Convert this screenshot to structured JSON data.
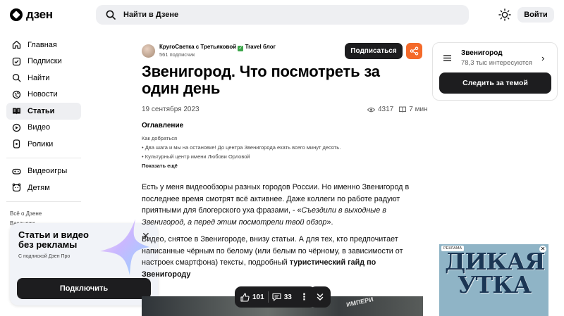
{
  "header": {
    "logo_text": "дзен",
    "search_placeholder": "Найти в Дзене",
    "login_label": "Войти"
  },
  "sidebar": {
    "items": [
      {
        "label": "Главная",
        "icon": "home-icon"
      },
      {
        "label": "Подписки",
        "icon": "subscriptions-icon"
      },
      {
        "label": "Найти",
        "icon": "search-icon"
      },
      {
        "label": "Новости",
        "icon": "globe-icon"
      },
      {
        "label": "Статьи",
        "icon": "articles-icon"
      },
      {
        "label": "Видео",
        "icon": "video-icon"
      },
      {
        "label": "Ролики",
        "icon": "shorts-icon"
      }
    ],
    "extra": [
      {
        "label": "Видеоигры",
        "icon": "gamepad-icon"
      },
      {
        "label": "Детям",
        "icon": "kids-icon"
      }
    ],
    "footer_links": [
      "Всё о Дзене",
      "Вакансии"
    ]
  },
  "promo": {
    "title": "Статьи и видео без рекламы",
    "subtitle": "С подпиской Дзен Про",
    "button": "Подключить"
  },
  "article": {
    "author_name": "КругоСветка с Третьяковой",
    "author_suffix": "Travel блог",
    "subscribers": "561 подписчик",
    "subscribe_label": "Подписаться",
    "title": "Звенигород. Что посмотреть за один день",
    "date": "19 сентября 2023",
    "views": "4317",
    "read_time": "7 мин",
    "toc_heading": "Оглавление",
    "toc": [
      "Как добраться",
      "• Два шага и мы на остановке! До центра Звенигорода ехать всего минут десять.",
      "• Культурный центр имени Любови Орловой"
    ],
    "toc_more": "Показать ещё",
    "p1_text": "Есть у меня видеообзоры разных городов России. Но именно Звенигород в последнее время смотрят всё активнее. Даже коллеги по работе радуют приятными для блогерского уха фразами, - «",
    "p1_italic": "Съездили в выходные в Звенигород, а перед этим посмотрели твой обзор",
    "p1_end": "».",
    "p2_text": "Видео, снятое в Звенигороде, внизу статьи. А для тех, кто предпочитает написанные чёрным по белому (или белым по чёрному, в зависимости от настроек смартфона) тексты, подробный ",
    "p2_bold": "туристический гайд по Звенигороду",
    "photo_text": "ИМПЕРИ"
  },
  "action_bar": {
    "likes": "101",
    "comments": "33"
  },
  "topic_widget": {
    "title": "Звенигород",
    "subtitle": "78,3 тыс интересуются",
    "button": "Следить за темой"
  },
  "ad": {
    "tag": "РЕКЛАМА",
    "text": "ДИКАЯ УТКА"
  },
  "colors": {
    "accent_dark": "#1d1d1f",
    "share_orange": "#f46a2a",
    "bg_light": "#eeeff2"
  }
}
